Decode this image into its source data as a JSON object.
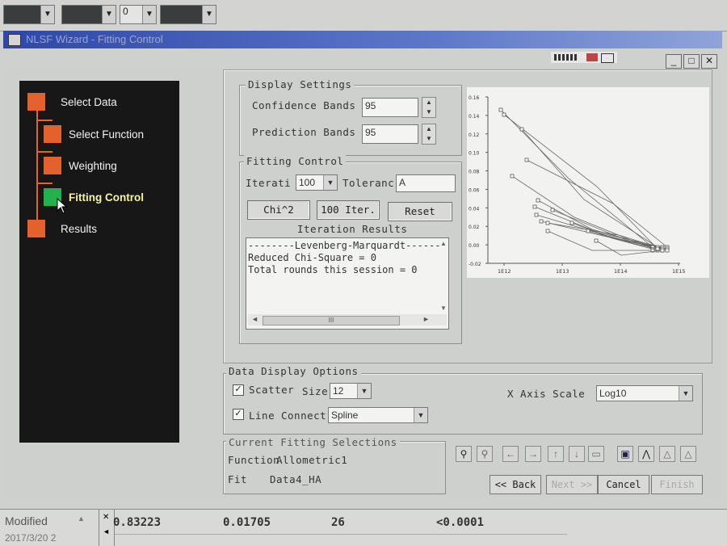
{
  "toolbar": {
    "combo3": "0"
  },
  "window": {
    "title": "NLSF Wizard - Fitting Control"
  },
  "wizard": {
    "steps": [
      {
        "label": "Select Data"
      },
      {
        "label": "Select Function"
      },
      {
        "label": "Weighting"
      },
      {
        "label": "Fitting Control"
      },
      {
        "label": "Results"
      }
    ],
    "active_color": "#22b14c",
    "step_color": "#e2612d"
  },
  "display_settings": {
    "title": "Display Settings",
    "confidence_label": "Confidence Bands",
    "confidence_value": "95",
    "prediction_label": "Prediction Bands",
    "prediction_value": "95"
  },
  "fitting_control": {
    "title": "Fitting Control",
    "iter_label": "Iterati",
    "iter_value": "100",
    "tol_label": "Toleranc",
    "tol_value": "A",
    "chi2_button": "Chi^2",
    "iter100_button": "100 Iter.",
    "reset_button": "Reset",
    "results_title": "Iteration Results",
    "results_lines": [
      "--------Levenberg-Marquardt------",
      "Reduced Chi-Square = 0",
      "Total rounds this session = 0"
    ],
    "hscroll_glyph": "III"
  },
  "preview": {
    "y_ticks": [
      "0.16",
      "0.14",
      "0.12",
      "0.10",
      "0.08",
      "0.06",
      "0.04",
      "0.02",
      "0.00",
      "-0.02"
    ],
    "x_ticks": [
      "1E12",
      "1E13",
      "1E14",
      "1E15"
    ]
  },
  "data_display": {
    "title": "Data Display Options",
    "scatter_label": "Scatter",
    "size_label": "Size",
    "size_value": "12",
    "line_label": "Line",
    "connect_label": "Connect",
    "connect_value": "Spline",
    "xaxis_label": "X Axis Scale",
    "xaxis_value": "Log10",
    "scatter_checked": "✓",
    "line_checked": "✓"
  },
  "current": {
    "title": "Current Fitting Selections",
    "function_label": "Function",
    "function_value": "Allometric1",
    "fit_label": "Fit",
    "fit_value": "Data4_HA"
  },
  "nav": {
    "back": "<< Back",
    "next": "Next >>",
    "cancel": "Cancel",
    "finish": "Finish"
  },
  "status": {
    "modified": "Modified",
    "date": "2017/3/20 2",
    "v1": "0.83223",
    "v2": "0.01705",
    "v3": "26",
    "v4": "<0.0001"
  }
}
